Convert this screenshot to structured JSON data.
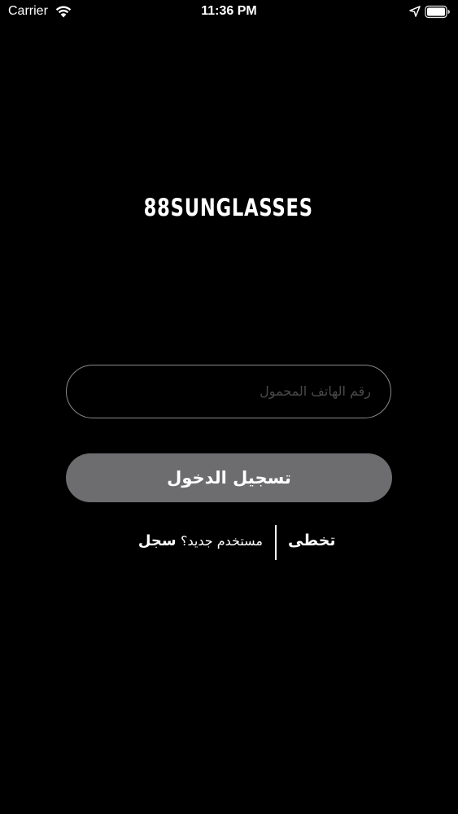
{
  "status_bar": {
    "carrier": "Carrier",
    "time": "11:36 PM",
    "icons": [
      "wifi-icon",
      "location-arrow-icon",
      "battery-icon"
    ]
  },
  "brand": {
    "name": "88SUNGLASSES"
  },
  "login_form": {
    "phone_placeholder": "رقم الهاتف المحمول",
    "phone_value": "",
    "login_button_label": "تسجيل الدخول"
  },
  "links": {
    "register_prefix": "مستخدم جديد؟",
    "register_action": "سجل",
    "skip_label": "تخطى"
  },
  "colors": {
    "background": "#000000",
    "text": "#ffffff",
    "button_background": "#6d6d70",
    "input_border": "#8a8a8a",
    "placeholder": "#4a4a4a"
  }
}
